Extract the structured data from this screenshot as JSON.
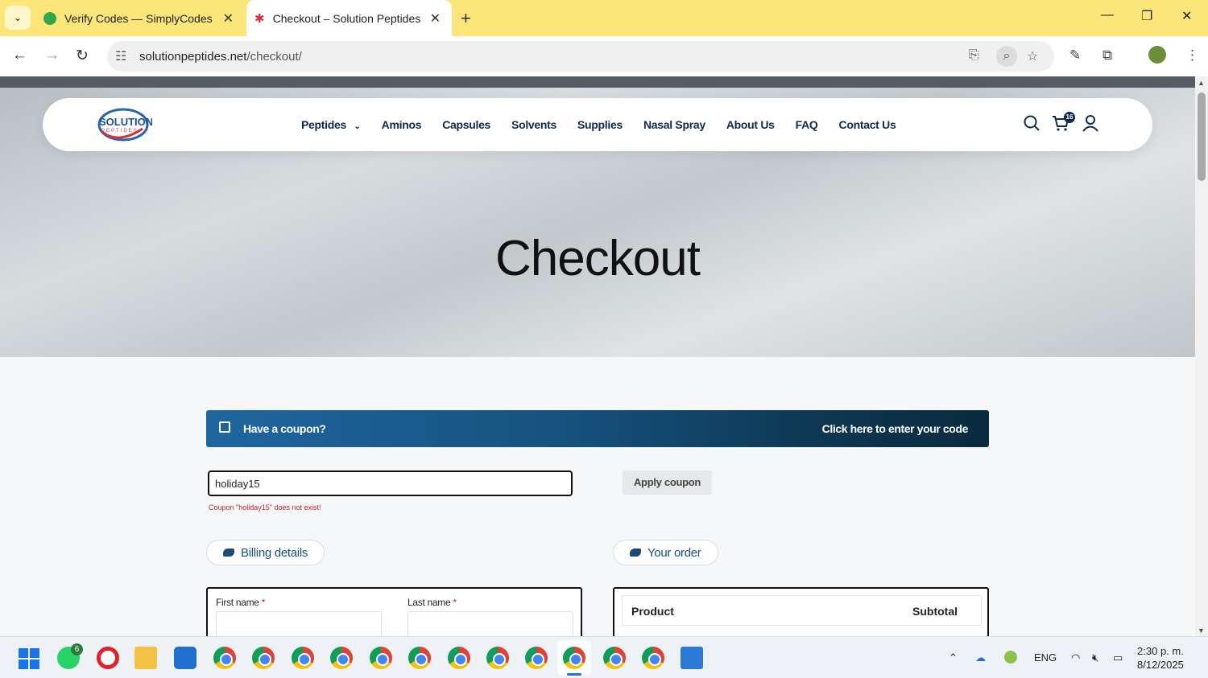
{
  "browser": {
    "tabs": [
      {
        "title": "Verify Codes — SimplyCodes",
        "active": false
      },
      {
        "title": "Checkout – Solution Peptides",
        "active": true
      }
    ],
    "url_host": "solutionpeptides.net",
    "url_path": "/checkout/"
  },
  "header": {
    "logo_text": "SOLUTION",
    "logo_sub": "PEPTIDES",
    "nav": [
      "Peptides",
      "Aminos",
      "Capsules",
      "Solvents",
      "Supplies",
      "Nasal Spray",
      "About Us",
      "FAQ",
      "Contact Us"
    ],
    "cart_count": "16"
  },
  "hero": {
    "title": "Checkout"
  },
  "coupon": {
    "prompt": "Have a coupon?",
    "link": "Click here to enter your code",
    "input_value": "holiday15",
    "error": "Coupon \"holiday15\" does not exist!",
    "apply_label": "Apply coupon"
  },
  "billing": {
    "heading": "Billing details",
    "first_name_label": "First name",
    "last_name_label": "Last name",
    "required_mark": "*"
  },
  "order": {
    "heading": "Your order",
    "col_product": "Product",
    "col_subtotal": "Subtotal"
  },
  "taskbar": {
    "whatsapp_badge": "6",
    "lang": "ENG",
    "time": "2:30 p. m.",
    "date": "8/12/2025"
  },
  "colors": {
    "tabbar": "#fce67a",
    "nav_text": "#0f2a4a",
    "coupon_gradient_start": "#1f66a0",
    "coupon_gradient_end": "#0a2b3e",
    "error": "#c0242f"
  }
}
